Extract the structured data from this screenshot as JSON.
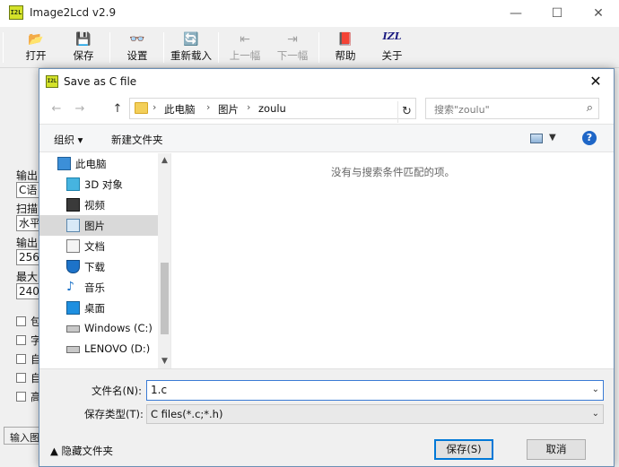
{
  "app": {
    "title": "Image2Lcd v2.9",
    "logo_text": "I2L",
    "window_controls": {
      "minimize": "—",
      "maximize": "☐",
      "close": "✕"
    },
    "toolbar": [
      {
        "label": "打开",
        "icon": "open-folder-icon",
        "glyph": "📂",
        "enabled": true
      },
      {
        "label": "保存",
        "icon": "save-disk-icon",
        "glyph": "💾",
        "enabled": true
      },
      {
        "label": "设置",
        "icon": "settings-glasses-icon",
        "glyph": "👓",
        "enabled": true
      },
      {
        "label": "重新载入",
        "icon": "reload-icon",
        "glyph": "🔄",
        "enabled": true
      },
      {
        "label": "上一幅",
        "icon": "previous-image-icon",
        "glyph": "⇤",
        "enabled": false
      },
      {
        "label": "下一幅",
        "icon": "next-image-icon",
        "glyph": "⇥",
        "enabled": false
      },
      {
        "label": "帮助",
        "icon": "help-book-icon",
        "glyph": "📕",
        "enabled": true
      },
      {
        "label": "关于",
        "icon": "about-izl-icon",
        "glyph": "IZL",
        "enabled": true
      }
    ],
    "left_panel": {
      "label_output": "输出",
      "value_c": "C语",
      "label_scan": "扫描",
      "value_scan": "水平",
      "label_output2": "输出",
      "value_256": "256",
      "label_max": "最大",
      "value_240": "240",
      "check_labels": [
        "包",
        "字",
        "自",
        "自",
        "高"
      ]
    },
    "status_left": "输入图"
  },
  "dialog": {
    "title": "Save as C file",
    "close_glyph": "✕",
    "nav": {
      "back": "←",
      "forward": "→",
      "up": "↑"
    },
    "breadcrumb": [
      "此电脑",
      "图片",
      "zoulu"
    ],
    "breadcrumb_sep": "›",
    "refresh_glyph": "↻",
    "search_placeholder": "搜索\"zoulu\"",
    "commands": {
      "organize": "组织 ▾",
      "new_folder": "新建文件夹"
    },
    "help_glyph": "?",
    "tree": [
      {
        "label": "此电脑",
        "icon": "this-pc-icon",
        "indent": 0,
        "selected": false
      },
      {
        "label": "3D 对象",
        "icon": "3d-objects-icon",
        "indent": 1,
        "selected": false
      },
      {
        "label": "视频",
        "icon": "videos-icon",
        "indent": 1,
        "selected": false
      },
      {
        "label": "图片",
        "icon": "pictures-icon",
        "indent": 1,
        "selected": true
      },
      {
        "label": "文档",
        "icon": "documents-icon",
        "indent": 1,
        "selected": false
      },
      {
        "label": "下载",
        "icon": "downloads-icon",
        "indent": 1,
        "selected": false
      },
      {
        "label": "音乐",
        "icon": "music-icon",
        "indent": 1,
        "selected": false
      },
      {
        "label": "桌面",
        "icon": "desktop-icon",
        "indent": 1,
        "selected": false
      },
      {
        "label": "Windows (C:)",
        "icon": "windows-drive-icon",
        "indent": 1,
        "selected": false
      },
      {
        "label": "LENOVO (D:)",
        "icon": "drive-icon",
        "indent": 1,
        "selected": false
      }
    ],
    "empty_message": "没有与搜索条件匹配的项。",
    "filename_label": "文件名(N):",
    "filename_value": "1.c",
    "filetype_label": "保存类型(T):",
    "filetype_value": "C files(*.c;*.h)",
    "hide_folders": "隐藏文件夹",
    "save_button": "保存(S)",
    "cancel_button": "取消"
  }
}
